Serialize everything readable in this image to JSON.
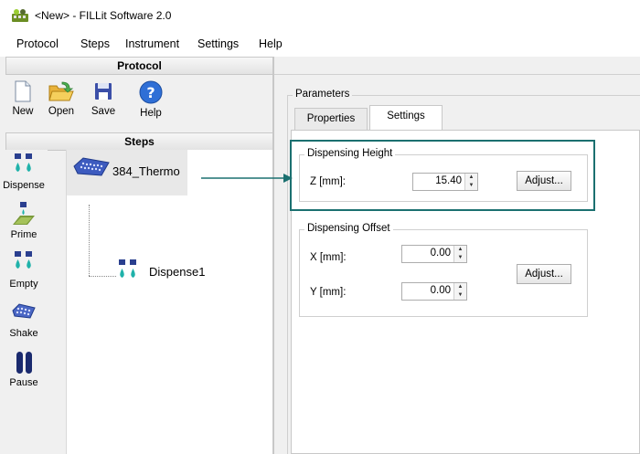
{
  "window": {
    "title": "<New> - FILLit Software 2.0"
  },
  "menu": [
    "Protocol",
    "Steps",
    "Instrument",
    "Settings",
    "Help"
  ],
  "left": {
    "protocol_header": "Protocol",
    "toolbar": [
      {
        "label": "New",
        "icon": "new-document-icon"
      },
      {
        "label": "Open",
        "icon": "open-folder-icon"
      },
      {
        "label": "Save",
        "icon": "save-floppy-icon"
      },
      {
        "label": "Help",
        "icon": "help-icon"
      }
    ],
    "steps_header": "Steps",
    "palette": [
      {
        "label": "Dispense",
        "icon": "dispense-icon"
      },
      {
        "label": "Prime",
        "icon": "prime-icon"
      },
      {
        "label": "Empty",
        "icon": "empty-icon"
      },
      {
        "label": "Shake",
        "icon": "shake-icon"
      },
      {
        "label": "Pause",
        "icon": "pause-icon"
      }
    ],
    "tree": {
      "root": "384_Thermo",
      "child": "Dispense1"
    }
  },
  "right": {
    "parameters_label": "Parameters",
    "tabs": [
      "Properties",
      "Settings"
    ],
    "active_tab": "Settings",
    "dispensing_height": {
      "legend": "Dispensing Height",
      "z_label": "Z [mm]:",
      "z_value": "15.40",
      "adjust_label": "Adjust..."
    },
    "dispensing_offset": {
      "legend": "Dispensing Offset",
      "x_label": "X [mm]:",
      "x_value": "0.00",
      "y_label": "Y [mm]:",
      "y_value": "0.00",
      "adjust_label": "Adjust..."
    }
  },
  "colors": {
    "highlight": "#1b7070",
    "arrow": "#1b7070"
  }
}
